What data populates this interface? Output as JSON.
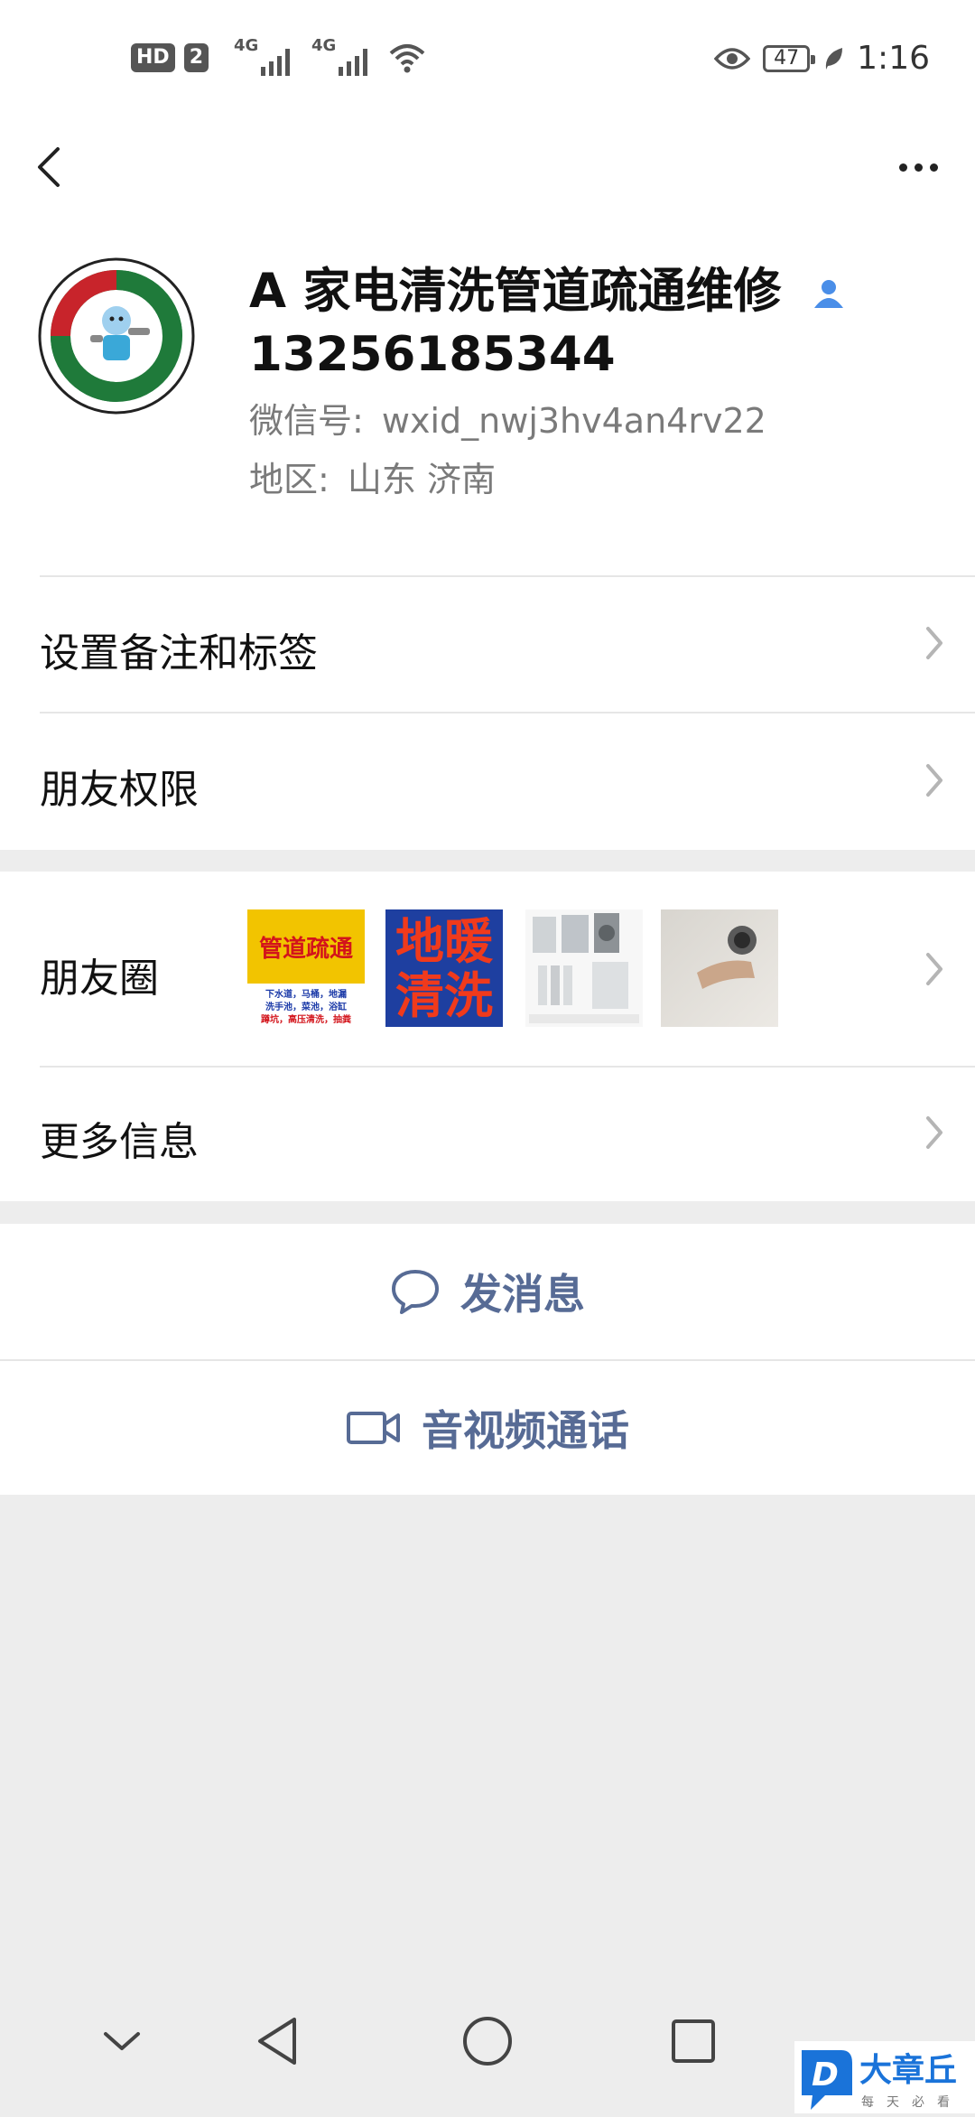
{
  "status_bar": {
    "hd": "HD",
    "sim": "2",
    "net1": "4G",
    "net2": "4G",
    "battery": "47",
    "time": "1:16"
  },
  "profile": {
    "name": "A 家电清洗管道疏通维修",
    "phone": "13256185344",
    "wechat_id_label": "微信号:",
    "wechat_id": "wxid_nwj3hv4an4rv22",
    "region_label": "地区:",
    "region": "山东 济南"
  },
  "menu": {
    "remarks": "设置备注和标签",
    "permissions": "朋友权限",
    "moments": "朋友圈",
    "more_info": "更多信息"
  },
  "moments_thumbs": [
    {
      "top": "管道疏通",
      "lines": [
        "下水道，马桶，地漏",
        "洗手池，菜池，浴缸",
        "蹲坑，高压清洗，抽粪"
      ]
    },
    {
      "text": "地暖清洗"
    }
  ],
  "actions": {
    "message": "发消息",
    "call": "音视频通话"
  },
  "watermark": {
    "letter": "D",
    "brand": "大章丘",
    "slogan": "每天必看"
  },
  "colors": {
    "link_blue": "#576b95",
    "verified": "#4a8ee8",
    "bg": "#ededed"
  }
}
